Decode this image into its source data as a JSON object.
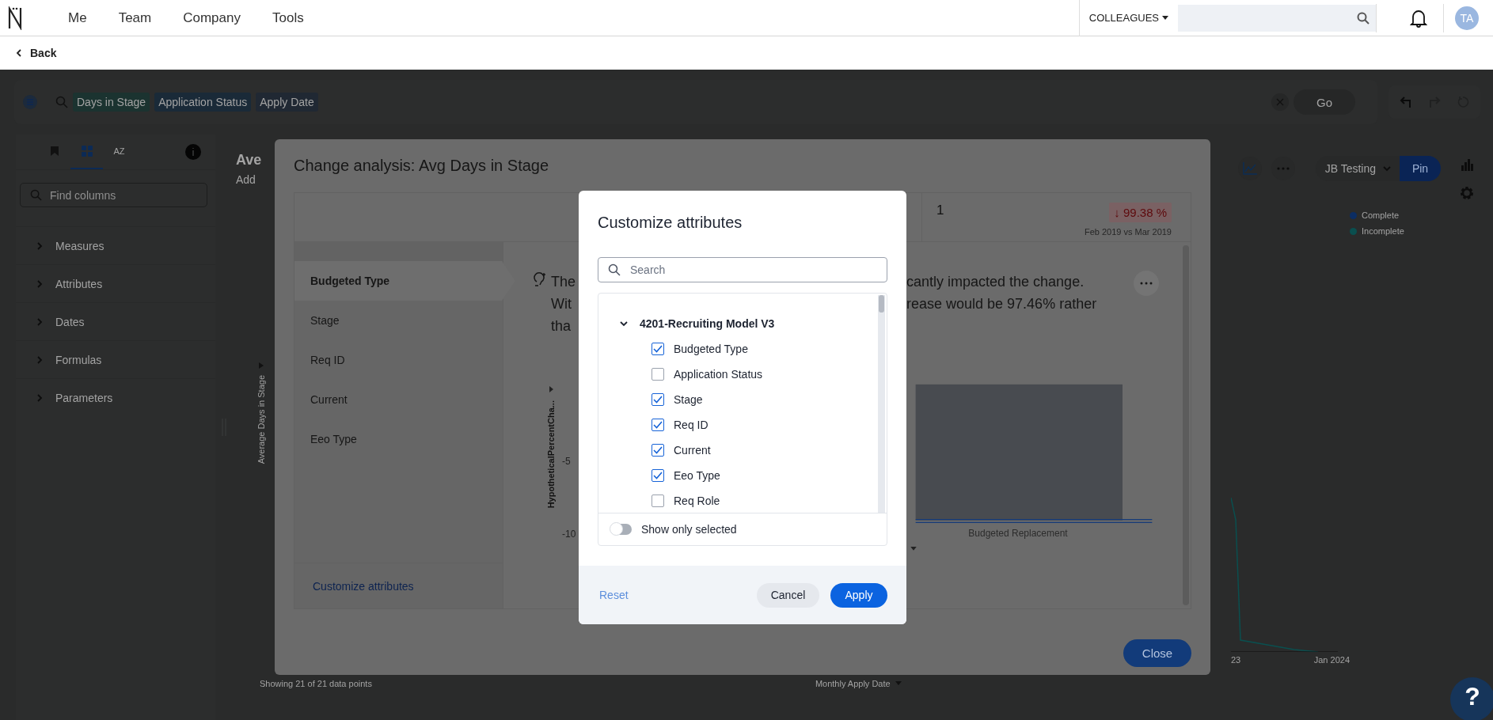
{
  "top_nav": {
    "menu": [
      {
        "label": "Me"
      },
      {
        "label": "Team"
      },
      {
        "label": "Company"
      },
      {
        "label": "Tools"
      }
    ],
    "scope_dropdown": "COLLEAGUES",
    "avatar": "TA"
  },
  "back_link": "Back",
  "search_bar": {
    "tokens": [
      "Days in Stage",
      "Application Status",
      "Apply Date"
    ],
    "go_button": "Go"
  },
  "left_panel": {
    "tabs": [
      {
        "kind": "bookmark",
        "selected": false
      },
      {
        "kind": "grid",
        "selected": true
      },
      {
        "kind": "sort",
        "label": "AZ",
        "selected": false
      }
    ],
    "search": {
      "placeholder": "Find columns"
    },
    "sections": [
      {
        "label": "Measures",
        "expanded": false
      },
      {
        "label": "Attributes",
        "expanded": false
      },
      {
        "label": "Dates",
        "expanded": false
      },
      {
        "label": "Formulas",
        "expanded": false
      },
      {
        "label": "Parameters",
        "expanded": false
      }
    ]
  },
  "answer": {
    "title": "Ave",
    "subtitle": "Add",
    "view_dropdown": "JB Testing",
    "pin_button": "Pin",
    "y_axis_label": "Average Days in Stage",
    "legend": [
      {
        "label": "Complete",
        "color": "#0b2d63"
      },
      {
        "label": "Incomplete",
        "color": "#0a4f4f"
      }
    ],
    "x_ticks": [
      "23",
      "Jan 2024"
    ],
    "x_axis_label": "Monthly Apply Date",
    "footer": "Showing 21 of 21 data points"
  },
  "help_button": "?",
  "change_analysis": {
    "title": "Change analysis: Avg Days in Stage",
    "stat": {
      "value": "1",
      "change": "↓ 99.38 %",
      "period": "Feb 2019 vs Mar 2019"
    },
    "attributes": [
      {
        "label": "Budgeted Type",
        "selected": true
      },
      {
        "label": "Stage",
        "selected": false
      },
      {
        "label": "Req ID",
        "selected": false
      },
      {
        "label": "Current",
        "selected": false
      },
      {
        "label": "Eeo Type",
        "selected": false
      }
    ],
    "customize_link": "Customize attributes",
    "insight_lines": [
      {
        "start": "The",
        "end": "cantly impacted the change."
      },
      {
        "start": "Wit",
        "end": "rease would be 97.46% rather"
      },
      {
        "start": "tha"
      }
    ],
    "chart": {
      "y_label": "HypotheticalPercentCha...",
      "y_ticks": [
        "-5",
        "-10"
      ],
      "category": "Budgeted Replacement"
    },
    "close_button": "Close"
  },
  "customize_dialog": {
    "title": "Customize attributes",
    "search": {
      "placeholder": "Search"
    },
    "group": {
      "label": "4201-Recruiting Model V3",
      "expanded": true,
      "children": [
        {
          "label": "Budgeted Type",
          "checked": true
        },
        {
          "label": "Application Status",
          "checked": false
        },
        {
          "label": "Stage",
          "checked": true
        },
        {
          "label": "Req ID",
          "checked": true
        },
        {
          "label": "Current",
          "checked": true
        },
        {
          "label": "Eeo Type",
          "checked": true
        },
        {
          "label": "Req Role",
          "checked": false
        }
      ]
    },
    "show_only_selected": {
      "label": "Show only selected",
      "on": false
    },
    "reset": {
      "label": "Reset",
      "disabled": true
    },
    "cancel_button": "Cancel",
    "apply_button": "Apply"
  }
}
